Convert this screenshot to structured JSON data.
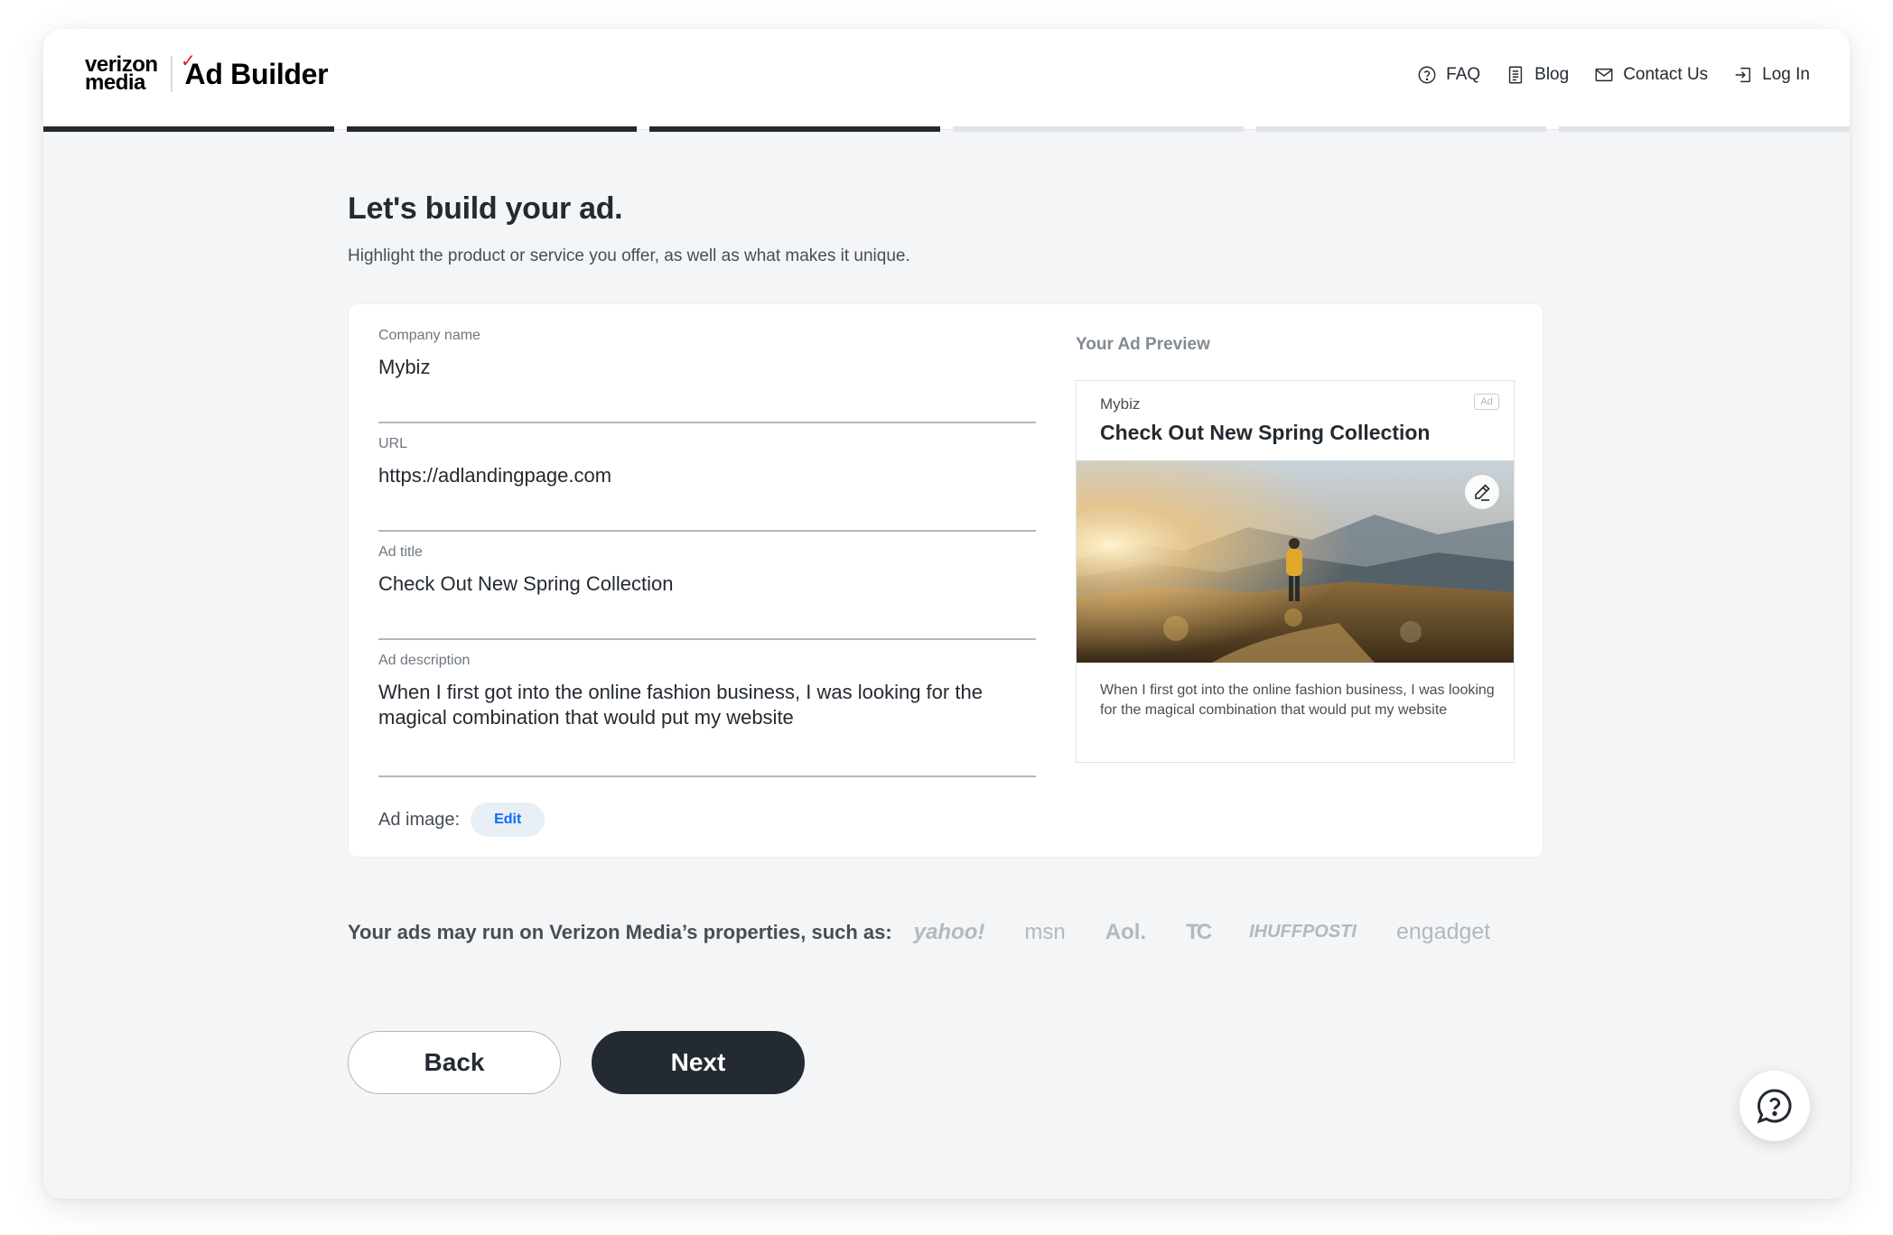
{
  "header": {
    "logo_line1": "verizon",
    "logo_line2": "media",
    "logo_check": "✓",
    "app_title": "Ad Builder",
    "nav": [
      {
        "label": "FAQ",
        "icon": "question-circle-icon"
      },
      {
        "label": "Blog",
        "icon": "document-icon"
      },
      {
        "label": "Contact Us",
        "icon": "envelope-icon"
      },
      {
        "label": "Log In",
        "icon": "login-icon"
      }
    ]
  },
  "progress": {
    "total_steps": 6,
    "completed_steps": 3
  },
  "page": {
    "title": "Let's build your ad.",
    "subtitle": "Highlight the product or service you offer, as well as what makes it unique."
  },
  "form": {
    "company_name": {
      "label": "Company name",
      "value": "Mybiz"
    },
    "url": {
      "label": "URL",
      "value": "https://adlandingpage.com"
    },
    "ad_title": {
      "label": "Ad title",
      "value": "Check Out New Spring Collection"
    },
    "ad_description": {
      "label": "Ad description",
      "value": "When I first got into the online fashion business, I was looking for the magical combination that would put my website"
    },
    "ad_image": {
      "label": "Ad image:",
      "edit_label": "Edit"
    }
  },
  "preview": {
    "label": "Your Ad Preview",
    "company": "Mybiz",
    "badge": "Ad",
    "title": "Check Out New Spring Collection",
    "description": "When I first got into the online fashion business, I was looking for the magical combination that would put my website"
  },
  "properties": {
    "text": "Your ads may run on Verizon Media’s properties, such as:",
    "brands": [
      "yahoo!",
      "msn",
      "Aol.",
      "TC",
      "IHUFFPOSTI",
      "engadget"
    ]
  },
  "actions": {
    "back_label": "Back",
    "next_label": "Next"
  },
  "colors": {
    "primary_dark": "#232a31",
    "accent_blue": "#0f69ff",
    "logo_red": "#e01a2b",
    "background": "#f4f5f7"
  }
}
